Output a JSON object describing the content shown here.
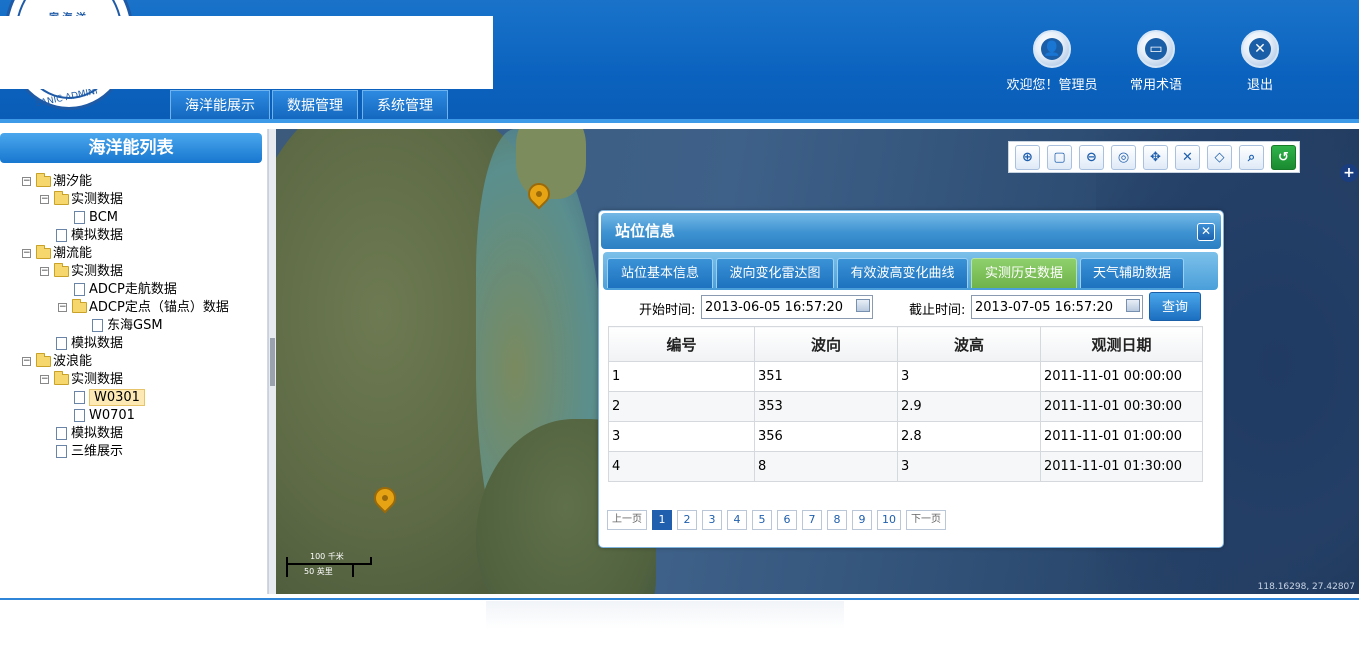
{
  "header": {
    "logo_text_top": "家 海 洋",
    "logo_text_bottom": "EANIC ADMINI",
    "nav": [
      "海洋能展示",
      "数据管理",
      "系统管理"
    ],
    "user_prefix": "欢迎您！",
    "user_name": "管理员",
    "terms": "常用术语",
    "logout": "退出"
  },
  "sidebar": {
    "title": "海洋能列表",
    "tree": {
      "n1": "潮汐能",
      "n1_1": "实测数据",
      "n1_1_1": "BCM",
      "n1_2": "模拟数据",
      "n2": "潮流能",
      "n2_1": "实测数据",
      "n2_1_1": "ADCP走航数据",
      "n2_1_2": "ADCP定点（锚点）数据",
      "n2_1_2_1": "东海GSM",
      "n2_2": "模拟数据",
      "n3": "波浪能",
      "n3_1": "实测数据",
      "n3_1_1": "W0301",
      "n3_1_2": "W0701",
      "n3_2": "模拟数据",
      "n3_3": "三维展示"
    }
  },
  "map": {
    "scale_top": "100 千米",
    "scale_bottom": "50 英里",
    "coords": "118.16298, 27.42807"
  },
  "dialog": {
    "title": "站位信息",
    "tabs": [
      "站位基本信息",
      "波向变化雷达图",
      "有效波高变化曲线",
      "实测历史数据",
      "天气辅助数据"
    ],
    "active_tab": 3,
    "start_label": "开始时间:",
    "start_value": "2013-06-05 16:57:20",
    "end_label": "截止时间:",
    "end_value": "2013-07-05 16:57:20",
    "query": "查询",
    "columns": [
      "编号",
      "波向",
      "波高",
      "观测日期"
    ],
    "rows": [
      [
        "1",
        "351",
        "3",
        "2011-11-01 00:00:00"
      ],
      [
        "2",
        "353",
        "2.9",
        "2011-11-01 00:30:00"
      ],
      [
        "3",
        "356",
        "2.8",
        "2011-11-01 01:00:00"
      ],
      [
        "4",
        "8",
        "3",
        "2011-11-01 01:30:00"
      ]
    ],
    "pager": {
      "prev": "上一页",
      "pages": [
        "1",
        "2",
        "3",
        "4",
        "5",
        "6",
        "7",
        "8",
        "9",
        "10"
      ],
      "next": "下一页",
      "current": "1"
    }
  },
  "colors": {
    "header_blue": "#0b63bf",
    "active_tab_green": "#7dc25a",
    "marker_yellow": "#e6a414"
  }
}
